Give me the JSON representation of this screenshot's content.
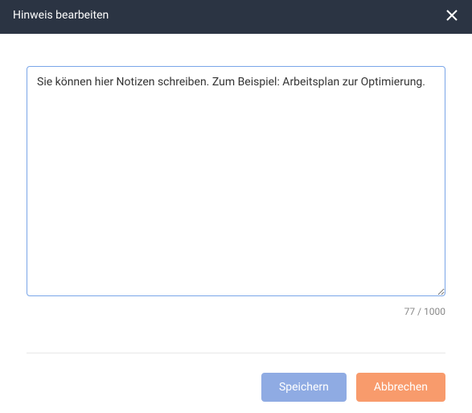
{
  "header": {
    "title": "Hinweis bearbeiten"
  },
  "form": {
    "note_value": "Sie können hier Notizen schreiben. Zum Beispiel: Arbeitsplan zur Optimierung.",
    "char_counter": "77 / 1000"
  },
  "footer": {
    "save_label": "Speichern",
    "cancel_label": "Abbrechen"
  }
}
